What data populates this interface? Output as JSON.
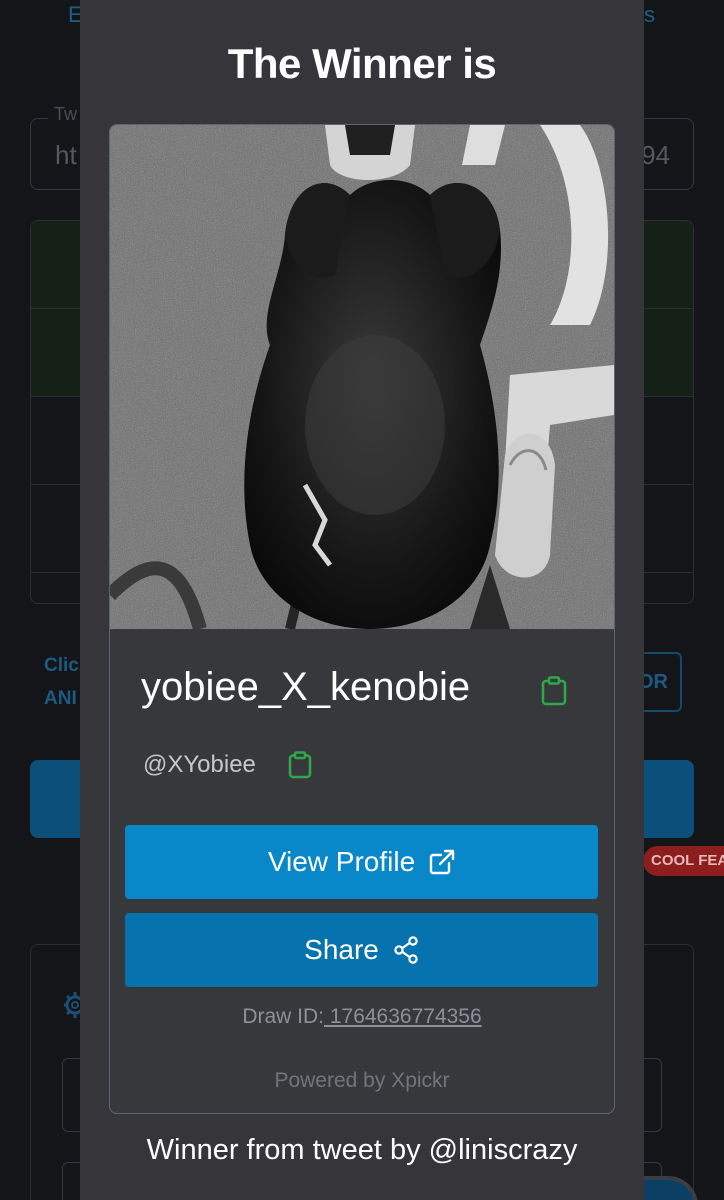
{
  "background": {
    "tab_left_fragment": "E",
    "tab_right_fragment": "s",
    "field_label_fragment": "Tw",
    "field_value_left_fragment": "ht",
    "field_value_right_fragment": "94",
    "link_line1_fragment": "Clic",
    "link_line2_fragment": "ANI",
    "or_button_fragment": "OR",
    "badge_text": "COOL FEAT"
  },
  "modal": {
    "title": "The Winner is",
    "winner": {
      "display_name": "yobiee_X_kenobie",
      "handle": "@XYobiee",
      "view_profile_label": "View Profile",
      "share_label": "Share",
      "draw_id_label": "Draw ID:",
      "draw_id_value": " 1764636774356",
      "powered_by": "Powered by Xpickr"
    },
    "footer": "Winner from tweet by @liniscrazy"
  },
  "icons": {
    "copy": "clipboard-icon",
    "external": "external-link-icon",
    "share": "share-nodes-icon",
    "settings": "gear-icon"
  },
  "colors": {
    "modal_bg": "#36363a",
    "primary_button": "#0887c9",
    "share_button": "#0672ae",
    "copy_icon": "#2ea84a",
    "page_bg": "#141518"
  }
}
